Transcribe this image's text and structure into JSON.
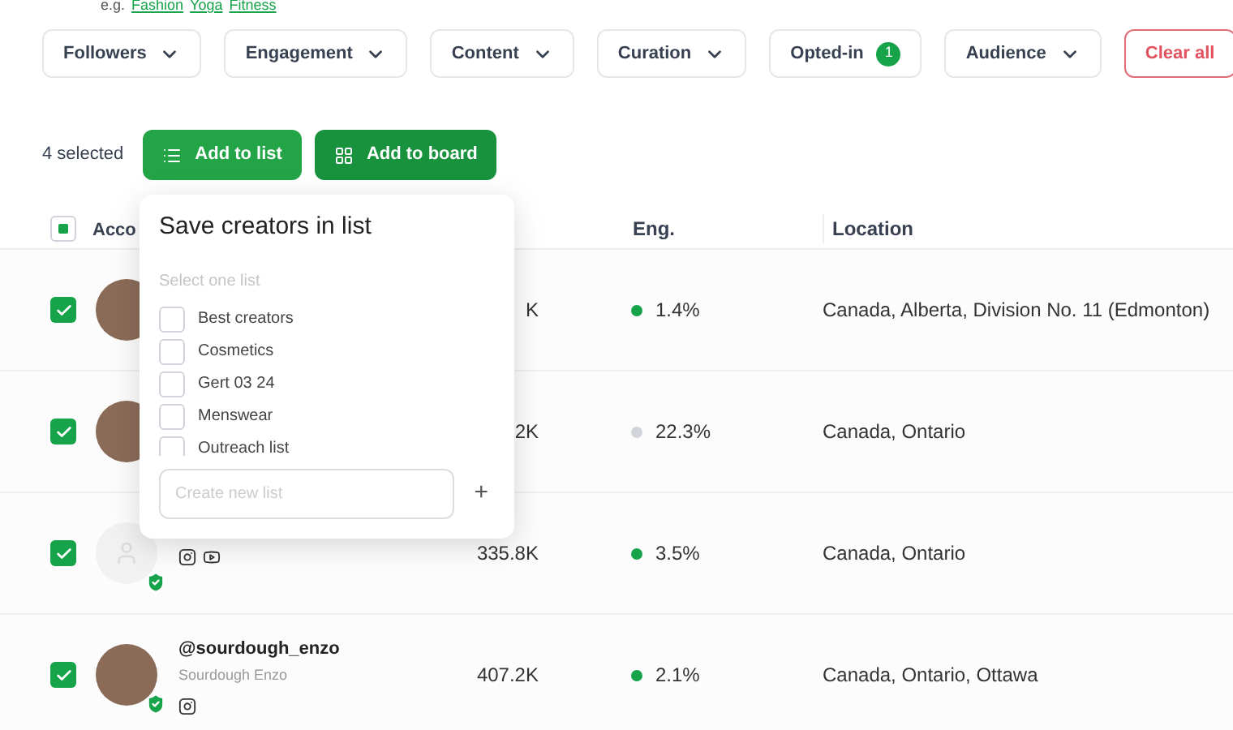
{
  "hint": {
    "prefix": "e.g.",
    "links": [
      "Fashion",
      "Yoga",
      "Fitness"
    ]
  },
  "filters": [
    {
      "label": "Followers",
      "kind": "dropdown"
    },
    {
      "label": "Engagement",
      "kind": "dropdown"
    },
    {
      "label": "Content",
      "kind": "dropdown"
    },
    {
      "label": "Curation",
      "kind": "dropdown"
    },
    {
      "label": "Opted-in",
      "kind": "count",
      "badge": "1"
    },
    {
      "label": "Audience",
      "kind": "dropdown"
    },
    {
      "label": "Clear all",
      "kind": "clear"
    }
  ],
  "selection": {
    "count": "4 selected",
    "buttons": [
      {
        "label": "Add to list"
      },
      {
        "label": "Add to board"
      }
    ]
  },
  "table": {
    "header_checkbox": {
      "indeterminate": true
    },
    "columns": [
      {
        "label": "Acco"
      },
      {
        "label": "Eng."
      },
      {
        "label": "Location"
      }
    ],
    "rows": [
      {
        "checked": true,
        "kind": "photo",
        "followers": "K",
        "eng": {
          "text": "1.4%",
          "color": "#16a34a"
        },
        "location": "Canada, Alberta, Division No. 11 (Edmonton)"
      },
      {
        "checked": true,
        "kind": "photo",
        "followers": "2K",
        "eng": {
          "text": "22.3%",
          "color": "#d1d5db"
        },
        "location": "Canada, Ontario"
      },
      {
        "checked": true,
        "kind": "placeholder",
        "verified": true,
        "socials": [
          {
            "kind": "instagram"
          },
          {
            "kind": "youtube"
          }
        ],
        "followers": "335.8K",
        "eng": {
          "text": "3.5%",
          "color": "#16a34a"
        },
        "location": "Canada, Ontario"
      },
      {
        "checked": true,
        "kind": "photo",
        "verified": true,
        "handle": "@sourdough_enzo",
        "name": "Sourdough Enzo",
        "socials": [
          {
            "kind": "instagram"
          }
        ],
        "followers": "407.2K",
        "eng": {
          "text": "2.1%",
          "color": "#16a34a"
        },
        "location": "Canada, Ontario, Ottawa"
      }
    ]
  },
  "popover": {
    "title": "Save creators in list",
    "subtitle": "Select one list",
    "options": [
      {
        "label": "Best creators",
        "checked": false
      },
      {
        "label": "Cosmetics",
        "checked": false
      },
      {
        "label": "Gert 03 24",
        "checked": false
      },
      {
        "label": "Menswear",
        "checked": false
      },
      {
        "label": "Outreach list",
        "checked": false
      }
    ],
    "input": {
      "placeholder": "Create new list"
    },
    "add": "+"
  }
}
